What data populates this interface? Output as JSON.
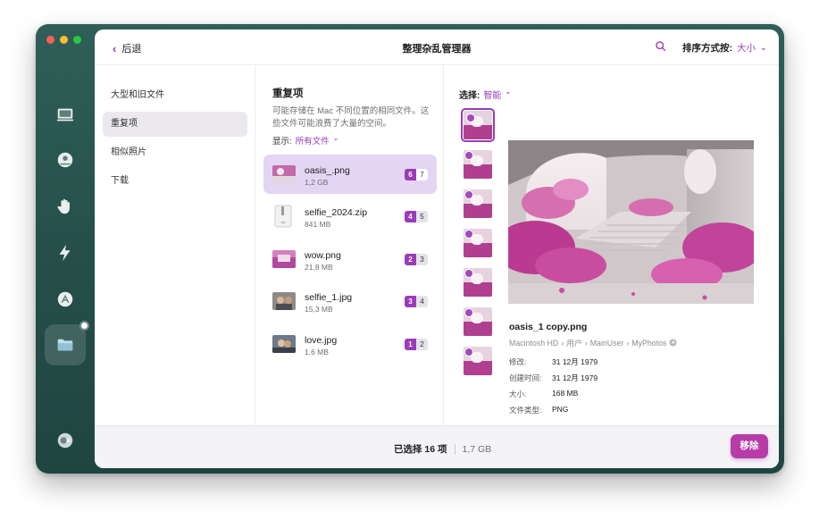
{
  "window": {
    "title": "整理杂乱管理器",
    "back_label": "后退",
    "sort_label": "排序方式按:",
    "sort_value": "大小",
    "accent_color": "#9b3bb8"
  },
  "sidebar_icons": [
    "monitor-icon",
    "disk-cleaner-icon",
    "hand-icon",
    "lightning-icon",
    "apps-icon",
    "folder-icon",
    "toggle-icon"
  ],
  "categories": [
    {
      "label": "大型和旧文件"
    },
    {
      "label": "重复项"
    },
    {
      "label": "相似照片"
    },
    {
      "label": "下载"
    }
  ],
  "middle": {
    "title": "重复项",
    "description": "可能存储在 Mac 不同位置的相同文件。这些文件可能浪费了大量的空间。",
    "show_label": "显示:",
    "show_value": "所有文件",
    "files": [
      {
        "name": "oasis_.png",
        "size": "1,2 GB",
        "selected": "6",
        "total": "7"
      },
      {
        "name": "selfie_2024.zip",
        "size": "841 MB",
        "selected": "4",
        "total": "5"
      },
      {
        "name": "wow.png",
        "size": "21,8 MB",
        "selected": "2",
        "total": "3"
      },
      {
        "name": "selfie_1.jpg",
        "size": "15,3 MB",
        "selected": "3",
        "total": "4"
      },
      {
        "name": "love.jpg",
        "size": "1,6 MB",
        "selected": "1",
        "total": "2"
      }
    ]
  },
  "right": {
    "select_label": "选择:",
    "select_value": "智能",
    "file_name": "oasis_1 copy.png",
    "path": [
      "Macintosh HD",
      "用户",
      "MainUser",
      "MyPhotos"
    ],
    "meta": [
      {
        "label": "修改:",
        "value": "31 12月 1979"
      },
      {
        "label": "创建时间:",
        "value": "31 12月 1979"
      },
      {
        "label": "大小:",
        "value": "168 MB"
      },
      {
        "label": "文件类型:",
        "value": "PNG"
      }
    ]
  },
  "footer": {
    "selected_text": "已选择 16 项",
    "total_size": "1,7 GB",
    "remove_label": "移除"
  }
}
